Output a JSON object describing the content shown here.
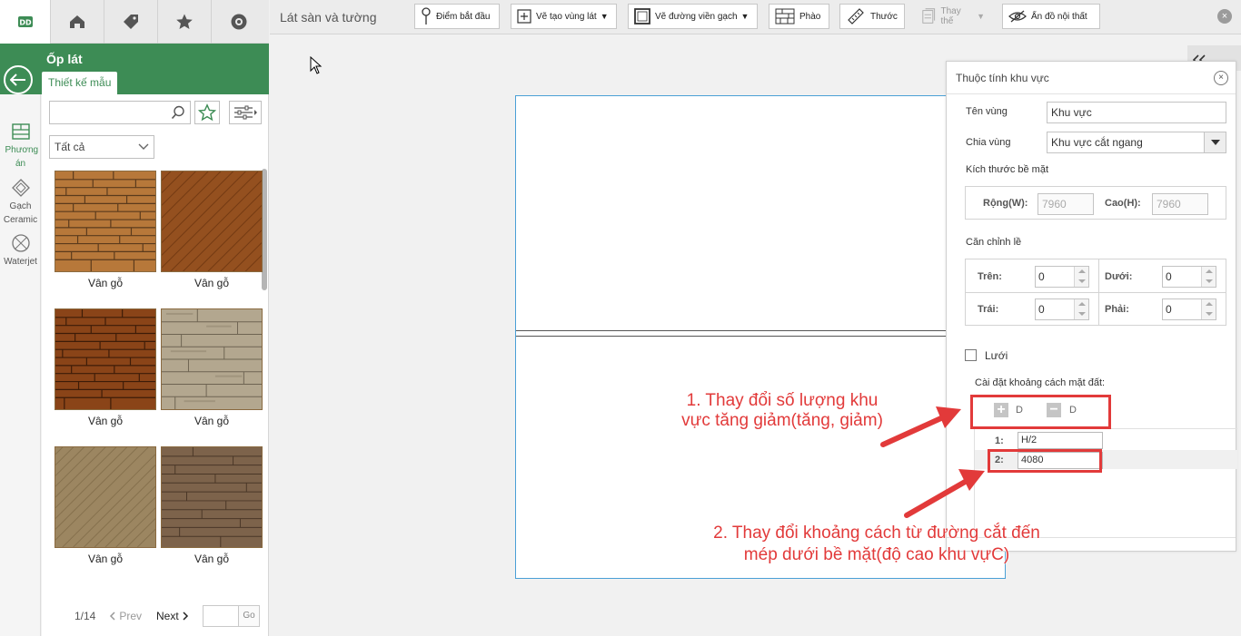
{
  "top_nav": {
    "items": [
      {
        "icon": "brand-logo-icon"
      },
      {
        "icon": "house-hands-icon"
      },
      {
        "icon": "tag-icon"
      },
      {
        "icon": "star-icon"
      },
      {
        "icon": "compass-icon"
      }
    ]
  },
  "sidebar": {
    "title": "Ốp lát",
    "tab_label": "Thiết kế mẫu",
    "rail": [
      {
        "label": "Phương án",
        "icon": "layout-plan-icon"
      },
      {
        "label": "Gạch Ceramic",
        "icon": "ceramic-tile-icon"
      },
      {
        "label": "Waterjet",
        "icon": "waterjet-icon"
      }
    ],
    "search_placeholder": "",
    "filter_select": "Tất cả",
    "tiles": [
      {
        "caption": "Vân gỗ"
      },
      {
        "caption": "Vân gỗ"
      },
      {
        "caption": "Vân gỗ"
      },
      {
        "caption": "Vân gỗ"
      },
      {
        "caption": "Vân gỗ"
      },
      {
        "caption": "Vân gỗ"
      }
    ],
    "pager": {
      "page": "1/14",
      "prev": "Prev",
      "next": "Next",
      "go": "Go"
    }
  },
  "toolbar": {
    "title": "Lát sàn và tường",
    "buttons": [
      {
        "label": "Điểm bắt đầu",
        "icon": "pin-icon"
      },
      {
        "label": "Vẽ tạo vùng lát",
        "icon": "draw-area-icon"
      },
      {
        "label": "Vẽ đường viền gạch",
        "icon": "border-icon"
      },
      {
        "label": "Phào",
        "icon": "brick-icon"
      },
      {
        "label": "Thước",
        "icon": "ruler-icon"
      },
      {
        "label": "Thay thế",
        "icon": "replace-icon"
      },
      {
        "label": "Ẩn đồ nội thất",
        "icon": "eye-off-icon"
      }
    ]
  },
  "panel": {
    "title": "Thuộc tính khu vực",
    "region_name_label": "Tên vùng",
    "region_name_value": "Khu vực",
    "split_label": "Chia vùng",
    "split_value": "Khu vực cắt ngang",
    "surface_size_label": "Kích thước bề mặt",
    "width_label": "Rộng(W):",
    "width_value": "7960",
    "height_label": "Cao(H):",
    "height_value": "7960",
    "align_label": "Căn chỉnh lề",
    "top_label": "Trên:",
    "top_value": "0",
    "bottom_label": "Dưới:",
    "bottom_value": "0",
    "left_label": "Trái:",
    "left_value": "0",
    "right_label": "Phải:",
    "right_value": "0",
    "grid_label": "Lưới",
    "ground_label": "Cài đặt khoảng cách mặt đất:",
    "add_label": "D",
    "remove_label": "D",
    "rows": [
      {
        "index": "1:",
        "value": "H/2"
      },
      {
        "index": "2:",
        "value": "4080"
      }
    ]
  },
  "annotations": {
    "note1": "1. Thay đổi số lượng khu vực tăng giảm(tăng, giảm)",
    "note1_line1": "1. Thay đổi số lượng khu",
    "note1_line2": "vực tăng giảm(tăng, giảm)",
    "note2_line1": "2. Thay đổi khoảng cách từ đường cắt đến",
    "note2_line2": "mép dưới bề mặt(độ cao khu vựC)",
    "color": "#e23a3a"
  },
  "colors": {
    "brand": "#3d8c55",
    "surface_border": "#4aa0d6"
  }
}
